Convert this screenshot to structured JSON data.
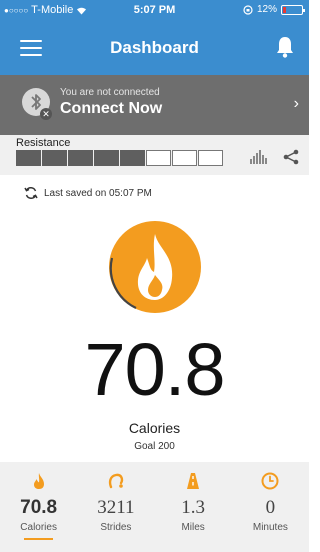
{
  "status_bar": {
    "signal": "●○○○○",
    "carrier": "T-Mobile",
    "time": "5:07 PM",
    "battery": "12%",
    "battery_level_percent": 12
  },
  "nav": {
    "title": "Dashboard"
  },
  "connect": {
    "subtitle": "You are not connected",
    "title": "Connect Now"
  },
  "resistance": {
    "label": "Resistance",
    "level": 5,
    "max": 8
  },
  "last_saved": "Last saved on 05:07 PM",
  "metric": {
    "value": "70.8",
    "label": "Calories",
    "goal": "Goal 200"
  },
  "tabs": [
    {
      "value": "70.8",
      "label": "Calories",
      "icon": "flame-icon",
      "active": true
    },
    {
      "value": "3211",
      "label": "Strides",
      "icon": "stride-icon",
      "active": false
    },
    {
      "value": "1.3",
      "label": "Miles",
      "icon": "road-icon",
      "active": false
    },
    {
      "value": "0",
      "label": "Minutes",
      "icon": "clock-icon",
      "active": false
    }
  ],
  "colors": {
    "header": "#3b8dcf",
    "connect_bar": "#6e6e6e",
    "accent": "#f39c1f",
    "panel": "#f0f0f0"
  }
}
